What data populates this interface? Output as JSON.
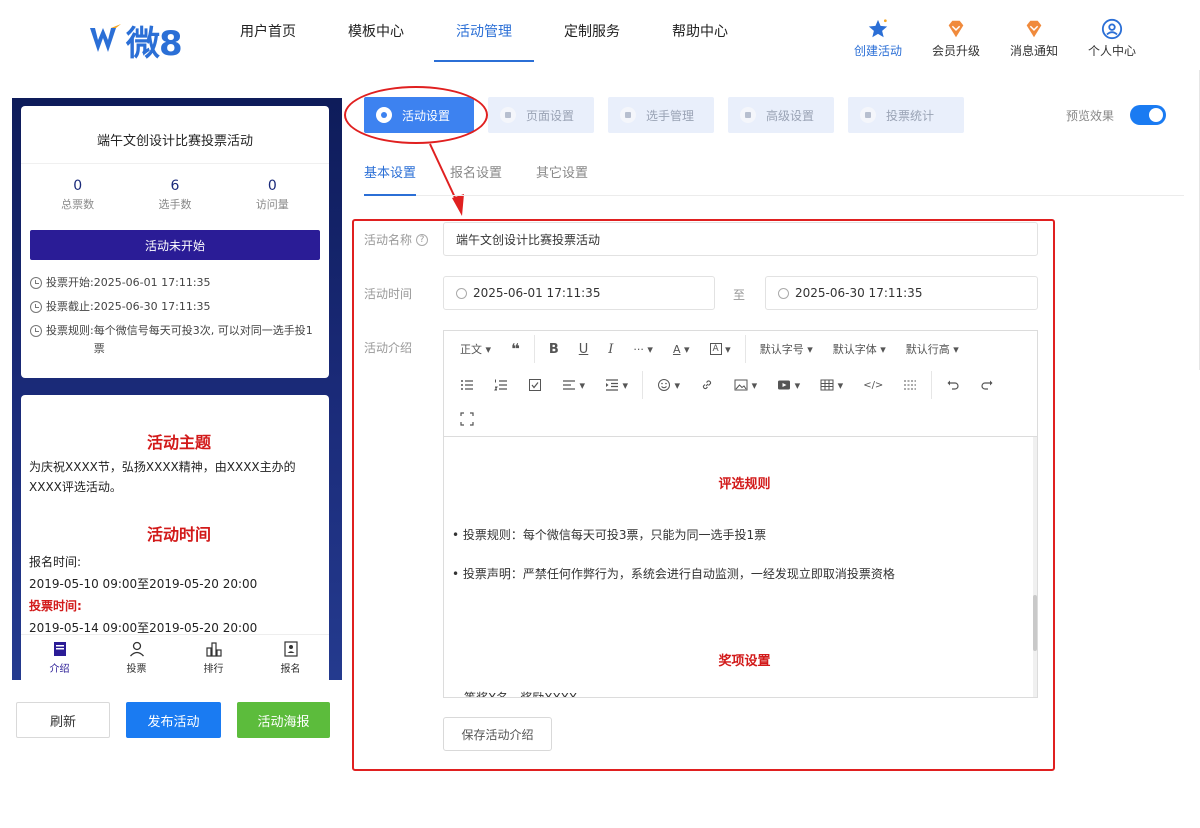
{
  "brand": {
    "logo_text": "微8"
  },
  "nav": [
    {
      "label": "用户首页"
    },
    {
      "label": "模板中心"
    },
    {
      "label": "活动管理",
      "active": true
    },
    {
      "label": "定制服务"
    },
    {
      "label": "帮助中心"
    }
  ],
  "top_icons": [
    {
      "label": "创建活动",
      "icon": "star-icon"
    },
    {
      "label": "会员升级",
      "icon": "vip-diamond-icon"
    },
    {
      "label": "消息通知",
      "icon": "bell-diamond-icon"
    },
    {
      "label": "个人中心",
      "icon": "user-circle-icon"
    }
  ],
  "preview": {
    "title": "端午文创设计比赛投票活动",
    "stats": [
      {
        "value": "0",
        "label": "总票数"
      },
      {
        "value": "6",
        "label": "选手数"
      },
      {
        "value": "0",
        "label": "访问量"
      }
    ],
    "status": "活动未开始",
    "info": [
      {
        "key": "投票开始:",
        "value": "2025-06-01 17:11:35"
      },
      {
        "key": "投票截止:",
        "value": "2025-06-30 17:11:35"
      },
      {
        "key": "投票规则:",
        "value": "每个微信号每天可投3次, 可以对同一选手投1票"
      }
    ],
    "theme_title": "活动主题",
    "theme_text": "为庆祝XXXX节，弘扬XXXX精神，由XXXX主办的XXXX评选活动。",
    "time_title": "活动时间",
    "signup_label": "报名时间:",
    "signup_range": "2019-05-10 09:00至2019-05-20 20:00",
    "vote_label": "投票时间:",
    "vote_range": "2019-05-14 09:00至2019-05-20 20:00",
    "tabs": [
      {
        "label": "介绍",
        "icon": "doc-icon",
        "active": true
      },
      {
        "label": "投票",
        "icon": "person-icon"
      },
      {
        "label": "排行",
        "icon": "bar-rank-icon"
      },
      {
        "label": "报名",
        "icon": "id-card-icon"
      }
    ]
  },
  "left_buttons": {
    "refresh": "刷新",
    "publish": "发布活动",
    "poster": "活动海报"
  },
  "panel_tabs": [
    {
      "label": "活动设置",
      "active": true
    },
    {
      "label": "页面设置"
    },
    {
      "label": "选手管理"
    },
    {
      "label": "高级设置"
    },
    {
      "label": "投票统计"
    }
  ],
  "preview_toggle": {
    "label": "预览效果",
    "on": true
  },
  "sub_tabs": [
    {
      "label": "基本设置",
      "active": true
    },
    {
      "label": "报名设置"
    },
    {
      "label": "其它设置"
    }
  ],
  "form": {
    "name_label": "活动名称",
    "name_value": "端午文创设计比赛投票活动",
    "time_label": "活动时间",
    "start": "2025-06-01 17:11:35",
    "to": "至",
    "end": "2025-06-30 17:11:35",
    "intro_label": "活动介绍"
  },
  "toolbar": {
    "paragraph": "正文",
    "font_size": "默认字号",
    "font_family": "默认字体",
    "line_height": "默认行高"
  },
  "editor_content": {
    "rules_heading": "评选规则",
    "rule1": "• 投票规则：每个微信每天可投3票，只能为同一选手投1票",
    "rule2": "• 投票声明：严禁任何作弊行为，系统会进行自动监测，一经发现立即取消投票资格",
    "awards_heading": "奖项设置",
    "award1": "一等奖X名，奖励XXXX"
  },
  "save_button": "保存活动介绍",
  "colors": {
    "primary": "#2b6fd6",
    "status_bg": "#2a1c96",
    "accent_red": "#d21a1a",
    "annotation": "#e02020",
    "publish": "#1a7bf2",
    "poster": "#5cbc3c"
  }
}
